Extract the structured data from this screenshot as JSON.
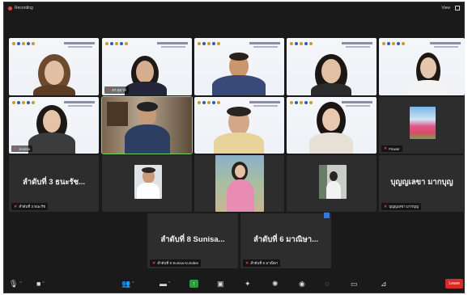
{
  "topbar": {
    "recording_label": "Recording",
    "view_label": "View"
  },
  "tiles": [
    {
      "id": "t1",
      "name": "",
      "big_text": ""
    },
    {
      "id": "t2",
      "name": "ดร.สุมาลี",
      "big_text": ""
    },
    {
      "id": "t3",
      "name": "",
      "big_text": ""
    },
    {
      "id": "t4",
      "name": "",
      "big_text": ""
    },
    {
      "id": "t5",
      "name": "",
      "big_text": ""
    },
    {
      "id": "t6",
      "name": "Sunisa",
      "big_text": ""
    },
    {
      "id": "t7",
      "name": "",
      "big_text": ""
    },
    {
      "id": "t8",
      "name": "",
      "big_text": ""
    },
    {
      "id": "t9",
      "name": "",
      "big_text": ""
    },
    {
      "id": "t10",
      "name": "Flower",
      "big_text": ""
    },
    {
      "id": "t11",
      "name": "ลำดับที่ 3 ธนะรัช",
      "big_text": "ลำดับที่ 3 ธนะรัช..."
    },
    {
      "id": "t12",
      "name": "",
      "big_text": ""
    },
    {
      "id": "t13",
      "name": "",
      "big_text": ""
    },
    {
      "id": "t14",
      "name": "",
      "big_text": ""
    },
    {
      "id": "t15",
      "name": "บุญญเลขา มากบุญ",
      "big_text": "บุญญเลขา มากบุญ"
    },
    {
      "id": "t16",
      "name": "ลำดับที่ 8 Sunisa Kumdee",
      "big_text": "ลำดับที่ 8 Sunisa..."
    },
    {
      "id": "t17",
      "name": "ลำดับที่ 6 มาณิษา",
      "big_text": "ลำดับที่ 6 มาณิษา..."
    }
  ],
  "toolbar": {
    "end_label": "Leave"
  },
  "colors": {
    "window_bg": "#1a1a1a",
    "tile_bg": "#2d2d2d",
    "active_border": "#7dd35b",
    "mic_muted": "#f04848",
    "share_green": "#2a9d3a",
    "leave_red": "#d62b2b"
  },
  "icons": [
    "mic-icon",
    "video-icon",
    "participants-icon",
    "chat-icon",
    "share-screen-icon",
    "record-icon",
    "reactions-icon",
    "apps-icon",
    "whiteboard-icon",
    "notes-icon",
    "more-icon",
    "expand-icon"
  ]
}
